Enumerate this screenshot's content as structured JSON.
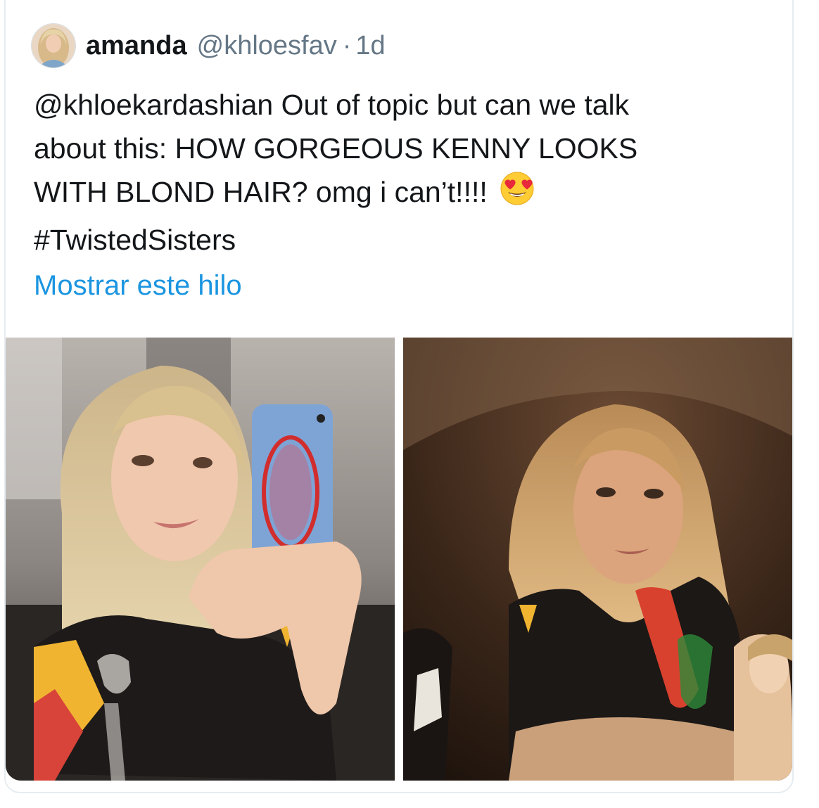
{
  "tweet": {
    "display_name": "amanda",
    "handle": "@khloesfav",
    "separator": "·",
    "time": "1d",
    "text_line1": "@khloekardashian Out of topic but can we talk",
    "text_line2": "about this: HOW GORGEOUS KENNY LOOKS",
    "text_line3": "WITH BLOND HAIR? omg i can’t!!!!",
    "emoji": "smiling-face-with-heart-eyes",
    "hashtag": "#TwistedSisters",
    "show_thread": "Mostrar este hilo"
  },
  "media": {
    "photos": [
      {
        "description_icon": "selfie-photo"
      },
      {
        "description_icon": "portrait-photo"
      }
    ]
  },
  "colors": {
    "text": "#14171a",
    "secondary": "#657786",
    "link": "#1b95e0",
    "border": "#e6ecf0"
  }
}
